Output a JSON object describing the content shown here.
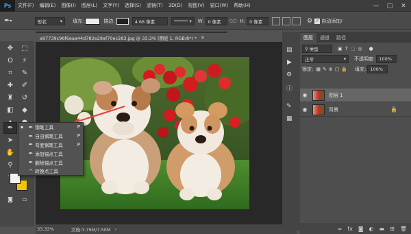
{
  "menubar": {
    "logo": "Ps",
    "items": [
      "文件(F)",
      "编辑(E)",
      "图像(I)",
      "图层(L)",
      "文字(Y)",
      "选择(S)",
      "滤镜(T)",
      "3D(D)",
      "视图(V)",
      "窗口(W)",
      "帮助(H)"
    ],
    "controls": [
      "—",
      "□",
      "✕"
    ]
  },
  "options": {
    "shape_mode": "形状",
    "fill_label": "填充:",
    "stroke_label": "描边:",
    "stroke_width": "4.68 像素",
    "w_label": "W:",
    "w_value": "0 像素",
    "go_label": "GO",
    "h_label": "H:",
    "h_value": "0 像素",
    "auto_add": "自动添加/"
  },
  "document": {
    "tab_title": "a97739c96f6eaa44d782e29af70ec283.jpg @ 33.3% (图层 1, RGB/8*) *",
    "zoom": "33.33%",
    "doc_info": "文档:3.79M/7.50M"
  },
  "tools": {
    "icons": [
      "move-icon",
      "marquee-icon",
      "lasso-icon",
      "magic-wand-icon",
      "crop-icon",
      "eyedropper-icon",
      "healing-icon",
      "brush-icon",
      "stamp-icon",
      "history-brush-icon",
      "eraser-icon",
      "paint-bucket-icon",
      "blur-icon",
      "dodge-icon",
      "pen-icon",
      "type-icon",
      "path-select-icon",
      "shape-icon",
      "hand-icon",
      "zoom-icon"
    ],
    "foreground_color": "#f3f3f3",
    "background_color": "#f2c40a"
  },
  "flyout": {
    "items": [
      {
        "label": "钢笔工具",
        "shortcut": "P",
        "selected": true
      },
      {
        "label": "自由钢笔工具",
        "shortcut": "P",
        "selected": false
      },
      {
        "label": "弯度钢笔工具",
        "shortcut": "P",
        "selected": false
      },
      {
        "label": "添加锚点工具",
        "shortcut": "",
        "selected": false
      },
      {
        "label": "删除锚点工具",
        "shortcut": "",
        "selected": false
      },
      {
        "label": "转换点工具",
        "shortcut": "",
        "selected": false
      }
    ]
  },
  "layers_panel": {
    "tabs": [
      "图层",
      "通道",
      "路径"
    ],
    "filter_label": "类型",
    "blend_mode": "正常",
    "opacity_label": "不透明度:",
    "opacity_value": "100%",
    "lock_label": "锁定:",
    "fill_label": "填充:",
    "fill_value": "100%",
    "layers": [
      {
        "name": "图层 1",
        "visible": true,
        "locked": false,
        "active": true
      },
      {
        "name": "背景",
        "visible": true,
        "locked": true,
        "active": false
      }
    ]
  },
  "annotation": {
    "arrow_color": "#e8423a"
  }
}
